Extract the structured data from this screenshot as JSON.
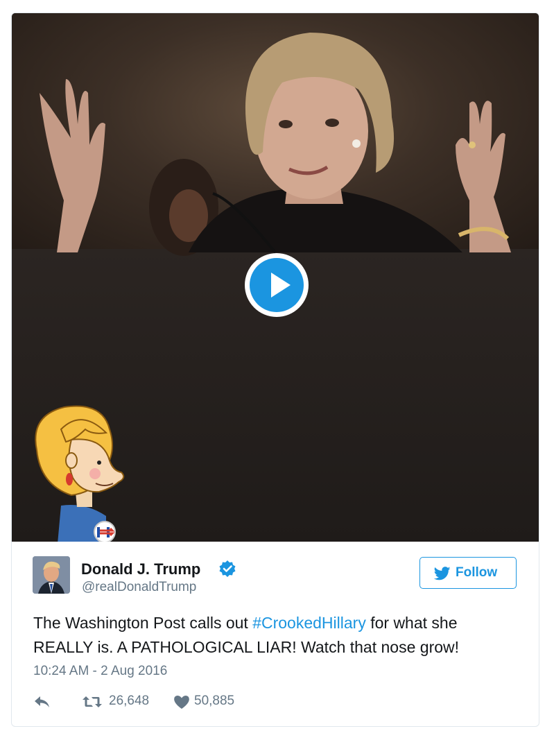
{
  "media": {
    "play_button": "play-icon",
    "sticker_badge_letter": "H"
  },
  "tweet": {
    "display_name": "Donald J. Trump",
    "handle": "@realDonaldTrump",
    "follow_label": "Follow",
    "text_before": "The Washington Post calls out ",
    "hashtag": "#CrookedHillary",
    "text_after": " for what she REALLY is. A PATHOLOGICAL LIAR! Watch that nose grow!",
    "timestamp": "10:24 AM - 2 Aug 2016",
    "retweet_count": "26,648",
    "like_count": "50,885"
  },
  "colors": {
    "accent": "#1b95e0",
    "secondary_text": "#657786",
    "primary_text": "#14171a"
  }
}
